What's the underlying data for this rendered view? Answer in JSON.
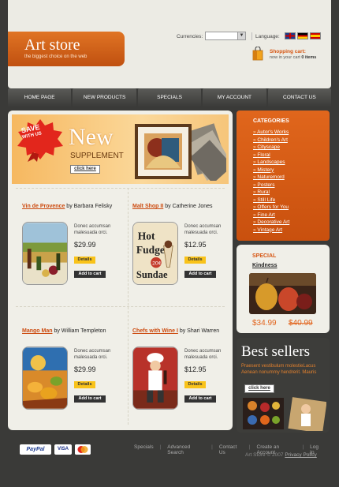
{
  "header": {
    "logo_title": "Art store",
    "logo_subtitle": "the biggest choice on the web",
    "currencies_label": "Currencies:",
    "language_label": "Language:",
    "cart_title": "Shopping cart:",
    "cart_status_prefix": "now in your cart",
    "cart_items": "0 items"
  },
  "nav": [
    "HOME PAGE",
    "NEW PRODUCTS",
    "SPECIALS",
    "MY ACCOUNT",
    "CONTACT US"
  ],
  "banner": {
    "save": "SAVE",
    "with_us": "WITH US",
    "title": "New",
    "subtitle": "SUPPLEMENT",
    "cta": "click here"
  },
  "products": [
    {
      "title": "Vin de Provence",
      "author": "by Barbara Felisky",
      "desc": "Donec accumsan malesuada orci.",
      "price": "$29.99",
      "details": "Details",
      "add": "Add to cart"
    },
    {
      "title": "Malt Shop II",
      "author": "by Catherine Jones",
      "desc": "Donec accumsan malesuada orci.",
      "price": "$12.95",
      "details": "Details",
      "add": "Add to cart"
    },
    {
      "title": "Mango Man",
      "author": "by William Templeton",
      "desc": "Donec accumsan malesuada orci.",
      "price": "$29.99",
      "details": "Details",
      "add": "Add to cart"
    },
    {
      "title": "Chefs with Wine I",
      "author": "by Shari Warren",
      "desc": "Donec accumsan malesuada orci.",
      "price": "$12.95",
      "details": "Details",
      "add": "Add to cart"
    }
  ],
  "malt_shop_art": {
    "line1": "Hot",
    "line2": "Fudge",
    "line3": "20¢",
    "line4": "Sundae"
  },
  "categories": {
    "title": "CATEGORIES",
    "items": [
      "Autor's Works",
      "Children's Art",
      "Cityscape",
      "Floral",
      "Landscapes",
      "Mistery",
      "Naturemord",
      "Posters",
      "Rural",
      "Still Life",
      "Offers for You",
      "Fine Art",
      "Decorative Art",
      "Vintage Art"
    ]
  },
  "special": {
    "title": "SPECIAL",
    "name": "Kindness",
    "price": "$34.99",
    "old_price": "$40.99"
  },
  "bestsellers": {
    "title": "Best sellers",
    "text": "Praesent vestibulum molestieLacus Aenean nonummy hendrerit. Mauris",
    "cta": "click here"
  },
  "footer": {
    "paypal": "PayPal",
    "visa": "VISA",
    "links": [
      "Specials",
      "Advanced Search",
      "Contact Us",
      "Create an Account",
      "Log In"
    ],
    "copyright": "Art Store © 2007",
    "privacy": "Privacy Policy"
  }
}
